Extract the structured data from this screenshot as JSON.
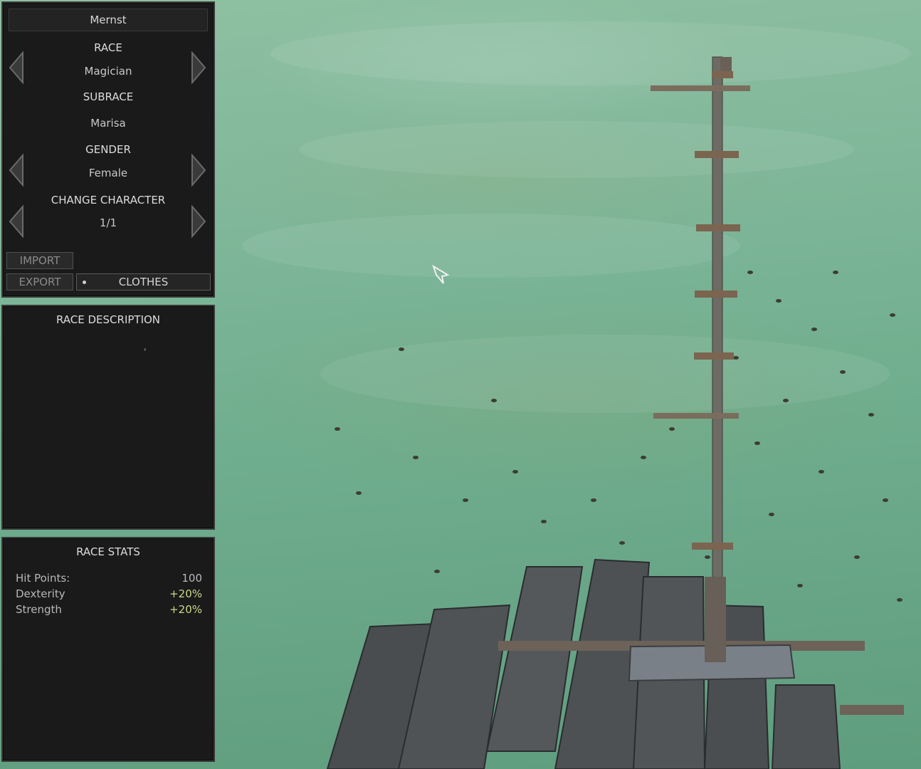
{
  "character": {
    "name": "Mernst",
    "race_label": "RACE",
    "race_value": "Magician",
    "subrace_label": "SUBRACE",
    "subrace_value": "Marisa",
    "gender_label": "GENDER",
    "gender_value": "Female",
    "change_label": "CHANGE CHARACTER",
    "change_value": "1/1"
  },
  "buttons": {
    "import": "IMPORT",
    "export": "EXPORT",
    "clothes": "CLOTHES"
  },
  "description": {
    "title": "RACE DESCRIPTION",
    "text": ","
  },
  "stats": {
    "title": "RACE STATS",
    "rows": [
      {
        "name": "Hit Points:",
        "value": "100"
      },
      {
        "name": "Dexterity",
        "value": "+20%"
      },
      {
        "name": "Strength",
        "value": "+20%"
      }
    ]
  },
  "colors": {
    "panel_bg": "#1a1a1a",
    "bonus_text": "#c9d98a",
    "terrain": "#7fb699"
  }
}
